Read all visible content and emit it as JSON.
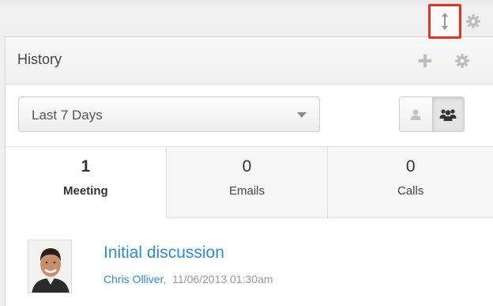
{
  "dashlet": {
    "title": "History",
    "filter": {
      "selected": "Last 7 Days"
    }
  },
  "tabs": [
    {
      "count": "1",
      "label": "Meeting",
      "active": true
    },
    {
      "count": "0",
      "label": "Emails",
      "active": false
    },
    {
      "count": "0",
      "label": "Calls",
      "active": false
    }
  ],
  "record": {
    "title": "Initial discussion",
    "author": "Chris Olliver",
    "separator": ",",
    "datetime": "11/06/2013 01:30am"
  },
  "icons": {
    "resize": "resize-vertical-icon",
    "gear": "gear-icon",
    "plus": "plus-icon",
    "user": "user-icon",
    "group": "group-icon"
  },
  "colors": {
    "highlight": "#e8321e",
    "link": "#2b8bd8",
    "muted": "#999999"
  }
}
